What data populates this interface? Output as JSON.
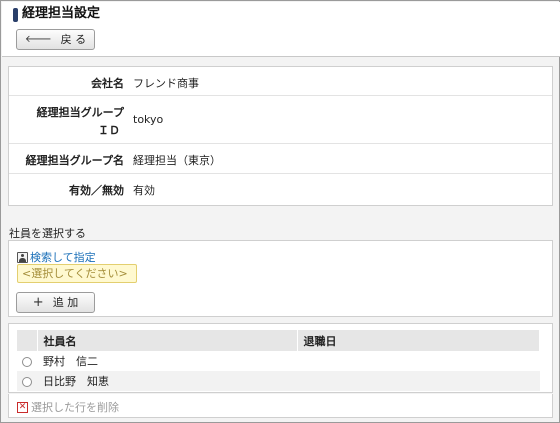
{
  "page": {
    "title": "経理担当設定"
  },
  "toolbar": {
    "back_label": "戻 る",
    "back_icon": "arrow-left-icon"
  },
  "info": {
    "rows": [
      {
        "label": "会社名",
        "value": "フレンド商事"
      },
      {
        "label_line1": "経理担当グループ",
        "label_line2": "ＩＤ",
        "value": "tokyo"
      },
      {
        "label": "経理担当グループ名",
        "value": "経理担当（東京）"
      },
      {
        "label": "有効／無効",
        "value": "有効"
      }
    ]
  },
  "employee_select": {
    "section_label": "社員を選択する",
    "search_link": "検索して指定",
    "placeholder": "<選択してください>",
    "add_label": "追 加"
  },
  "employee_table": {
    "columns": [
      "社員名",
      "退職日"
    ],
    "rows": [
      {
        "name": "野村　信二",
        "retire_date": ""
      },
      {
        "name": "日比野　知恵",
        "retire_date": ""
      }
    ]
  },
  "delete_link": "選択した行を削除",
  "colors": {
    "title_mark": "#2a3f6a",
    "link": "#1a6fb8",
    "placeholder_bg": "#fff9d0",
    "delete_icon": "#c92b2b"
  }
}
